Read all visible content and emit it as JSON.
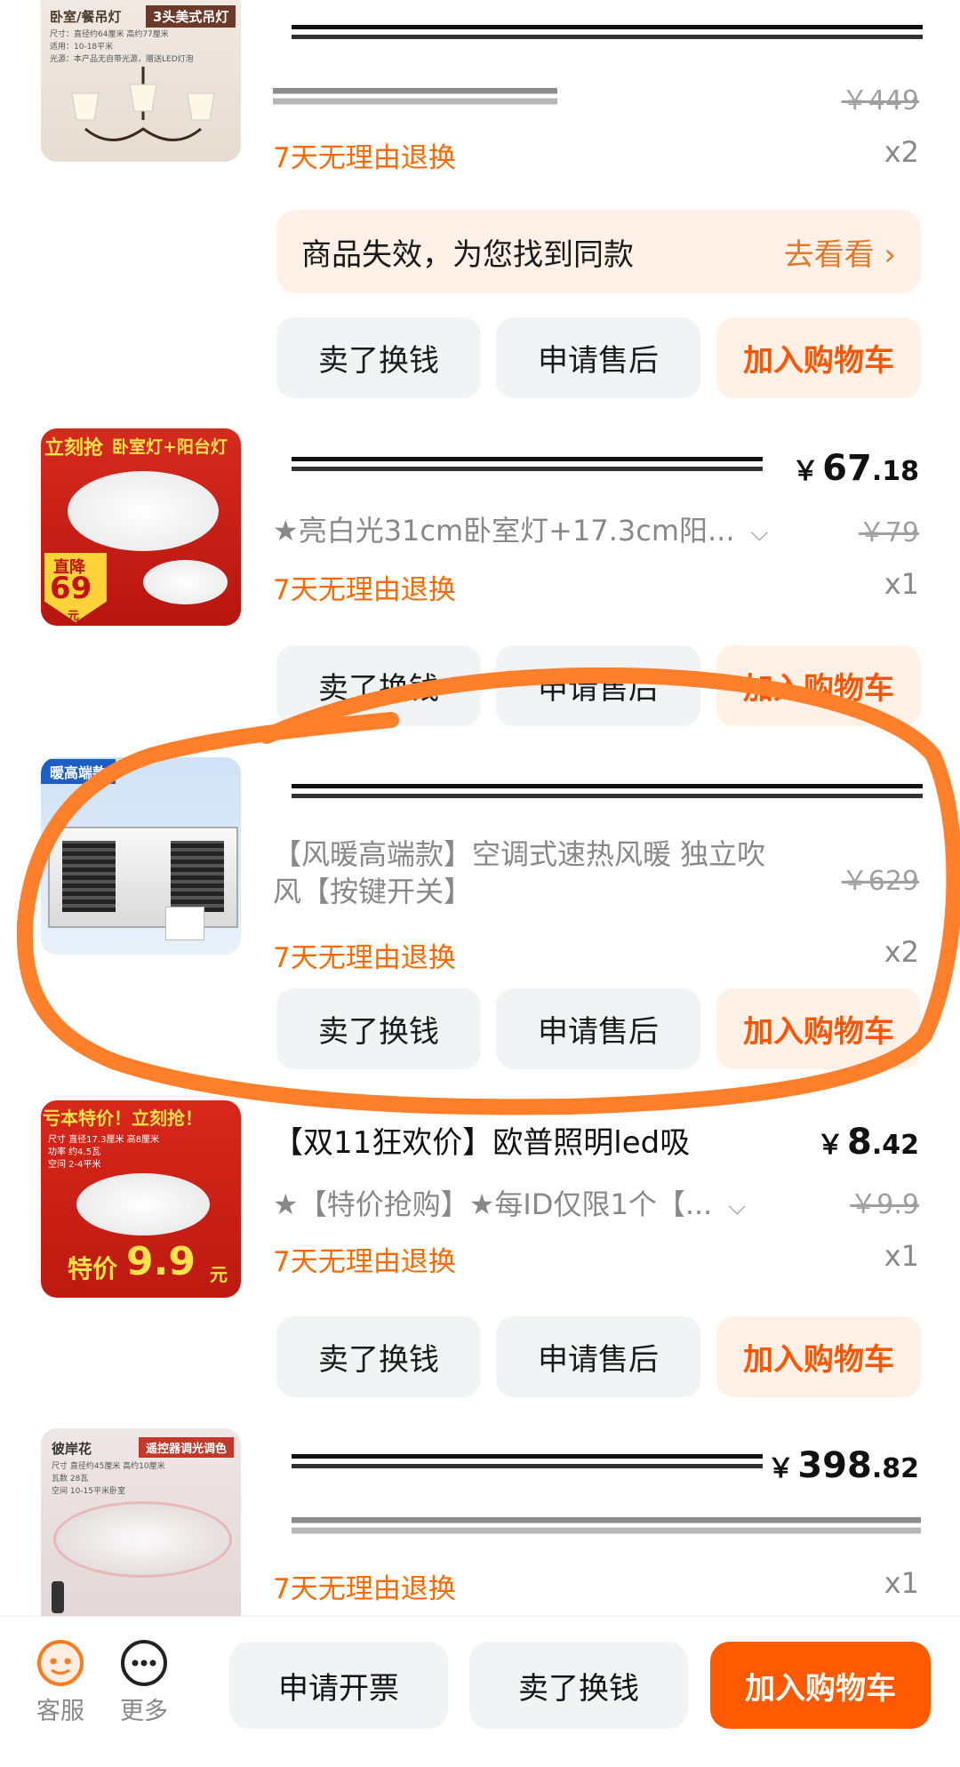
{
  "return_policy": "7天无理由退换",
  "buttons": {
    "sell": "卖了换钱",
    "after_sale": "申请售后",
    "add_cart": "加入购物车"
  },
  "notice": {
    "text": "商品失效，为您找到同款",
    "action": "去看看"
  },
  "items": [
    {
      "thumb_tags": [
        "卧室/餐吊灯",
        "3头美式吊灯"
      ],
      "thumb_detail": [
        "尺寸：直径约64厘米 高约77厘米",
        "适用：10-18平米",
        "光源：本产品无自带光源，赠送LED灯泡"
      ],
      "old_price": "￥449",
      "qty": "x2"
    },
    {
      "thumb_tags": [
        "立刻抢",
        "卧室灯+阳台灯",
        "直降",
        "69",
        "元"
      ],
      "price_cur": "￥",
      "price_int": "67",
      "price_dec": ".18",
      "spec": "★亮白光31cm卧室灯+17.3cm阳...",
      "old_price": "￥79",
      "qty": "x1"
    },
    {
      "thumb_tags": [
        "暖高端款"
      ],
      "title": "【风暖高端款】空调式速热风暖 独立吹风【按键开关】",
      "old_price": "￥629",
      "qty": "x2"
    },
    {
      "thumb_tags": [
        "亏本特价！立刻抢！",
        "特价",
        "9.9",
        "元"
      ],
      "thumb_detail": [
        "尺寸 直径17.3厘米 高8厘米",
        "功率 约4.5瓦",
        "空间 2-4平米"
      ],
      "title": "【双11狂欢价】欧普照明led吸",
      "price_cur": "￥",
      "price_int": "8",
      "price_dec": ".42",
      "spec": "★【特价抢购】★每ID仅限1个【...",
      "old_price": "￥9.9",
      "qty": "x1"
    },
    {
      "thumb_tags": [
        "彼岸花",
        "遥控器调光调色"
      ],
      "thumb_detail": [
        "尺寸 直径约45厘米 高约10厘米",
        "瓦数 28瓦",
        "空间 10-15平米卧室"
      ],
      "price_cur": "￥",
      "price_int": "398",
      "price_dec": ".82",
      "qty": "x1"
    }
  ],
  "bottom_bar": {
    "service": "客服",
    "more": "更多",
    "invoice": "申请开票",
    "sell": "卖了换钱",
    "add_cart": "加入购物车"
  },
  "colors": {
    "accent": "#ff5a00",
    "return_text": "#ff6a00",
    "scribble": "#ff7f2a"
  }
}
